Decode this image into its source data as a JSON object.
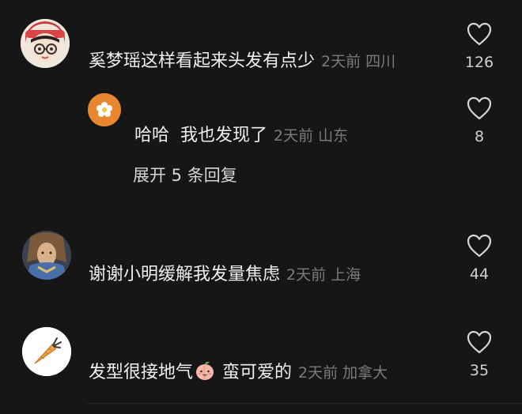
{
  "comments": [
    {
      "text": "奚梦瑶这样看起来头发有点少",
      "time": "2天前",
      "location": "四川",
      "likes": "126",
      "avatar": "cartoon-girl-with-glasses",
      "reply": {
        "text": "哈哈  我也发现了",
        "time": "2天前",
        "location": "山东",
        "likes": "8",
        "avatar": "orange-flower"
      },
      "expand_label": "展开 5 条回复"
    },
    {
      "text": "谢谢小明缓解我发量焦虑",
      "time": "2天前",
      "location": "上海",
      "likes": "44",
      "avatar": "fantasy-warrior"
    },
    {
      "text": "发型很接地气",
      "emoji": "peach-face",
      "text2": " 蛮可爱的",
      "time": "2天前",
      "location": "加拿大",
      "likes": "35",
      "avatar": "carrot"
    }
  ],
  "colors": {
    "background": "#161616",
    "text": "#f0f0f0",
    "meta": "#7b7b7b"
  }
}
